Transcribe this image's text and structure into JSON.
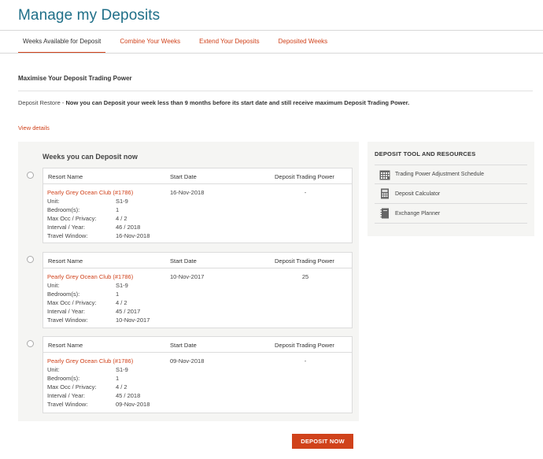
{
  "page": {
    "title": "Manage my Deposits"
  },
  "tabs": [
    {
      "label": "Weeks Available for Deposit"
    },
    {
      "label": "Combine Your Weeks"
    },
    {
      "label": "Extend Your Deposits"
    },
    {
      "label": "Deposited Weeks"
    }
  ],
  "info": {
    "title": "Maximise Your Deposit Trading Power",
    "restore_prefix": "Deposit Restore - ",
    "restore_text": "Now you can Deposit your week less than 9 months before its start date and still receive maximum Deposit Trading Power.",
    "view_details": "View details"
  },
  "weeks": {
    "title": "Weeks you can Deposit now",
    "columns": {
      "resort": "Resort Name",
      "start": "Start Date",
      "power": "Deposit Trading Power"
    },
    "detail_labels": {
      "unit": "Unit:",
      "bedrooms": "Bedroom(s):",
      "occ": "Max Occ / Privacy:",
      "interval": "Interval / Year:",
      "travel": "Travel Window:"
    },
    "items": [
      {
        "resort": "Pearly Grey Ocean Club (#1786)",
        "start": "16-Nov-2018",
        "power": "-",
        "unit": "S1-9",
        "bedrooms": "1",
        "occ": "4 / 2",
        "interval": "46 / 2018",
        "travel": "16-Nov-2018"
      },
      {
        "resort": "Pearly Grey Ocean Club (#1786)",
        "start": "10-Nov-2017",
        "power": "25",
        "unit": "S1-9",
        "bedrooms": "1",
        "occ": "4 / 2",
        "interval": "45 / 2017",
        "travel": "10-Nov-2017"
      },
      {
        "resort": "Pearly Grey Ocean Club (#1786)",
        "start": "09-Nov-2018",
        "power": "-",
        "unit": "S1-9",
        "bedrooms": "1",
        "occ": "4 / 2",
        "interval": "45 / 2018",
        "travel": "09-Nov-2018"
      }
    ]
  },
  "resources": {
    "title": "DEPOSIT TOOL AND RESOURCES",
    "items": [
      {
        "label": "Trading Power Adjustment Schedule",
        "icon": "calendar-icon"
      },
      {
        "label": "Deposit Calculator",
        "icon": "calculator-icon"
      },
      {
        "label": "Exchange Planner",
        "icon": "planner-book-icon"
      }
    ]
  },
  "actions": {
    "deposit_now": "DEPOSIT NOW"
  },
  "colors": {
    "accent": "#d0421b",
    "title": "#1f6f88",
    "panel": "#f5f5f3"
  }
}
